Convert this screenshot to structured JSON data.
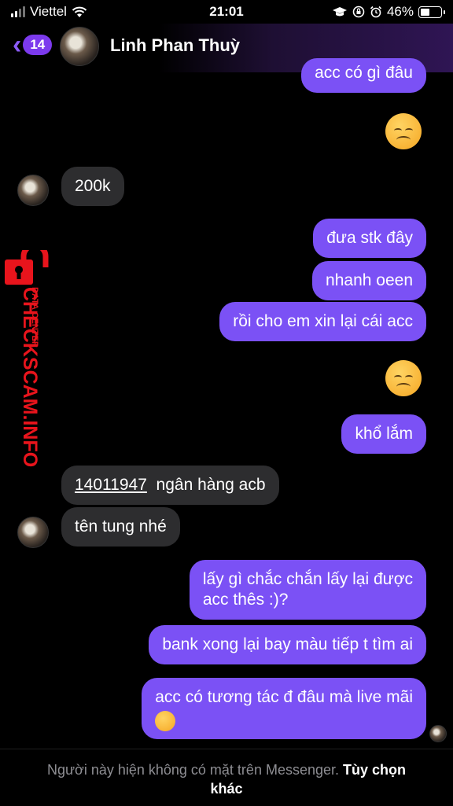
{
  "status_bar": {
    "carrier": "Viettel",
    "time": "21:01",
    "battery": "46%"
  },
  "header": {
    "back_count": "14",
    "contact_name": "Linh Phan Thuỳ"
  },
  "messages": [
    {
      "from": "me",
      "text": "acc có gì đâu"
    },
    {
      "from": "me",
      "type": "emoji",
      "icon": "disappointed-face-emoji"
    },
    {
      "from": "them",
      "text": "200k"
    },
    {
      "from": "me",
      "text": "đưa stk đây"
    },
    {
      "from": "me",
      "text": "nhanh oeen"
    },
    {
      "from": "me",
      "text": "rồi cho em xin lại cái acc"
    },
    {
      "from": "me",
      "type": "emoji",
      "icon": "disappointed-face-emoji"
    },
    {
      "from": "me",
      "text": "khổ lắm"
    },
    {
      "from": "them",
      "link": "14011947",
      "text": "ngân hàng acb"
    },
    {
      "from": "them",
      "text": "tên tung nhé"
    },
    {
      "from": "me",
      "lines": [
        "lấy gì chắc chắn lấy lại được",
        "acc thês :)?"
      ]
    },
    {
      "from": "me",
      "text": "bank xong lại bay màu tiếp t tìm ai"
    },
    {
      "from": "me",
      "lines": [
        "acc có tương tác đ đâu mà live mãi"
      ],
      "trailing_emoji": "disappointed-face-emoji"
    }
  ],
  "watermark": {
    "brand": "CHECKSCAM.INFO",
    "tag": "DATA CENTER"
  },
  "footer": {
    "notice": "Người này hiện không có mặt trên Messenger.",
    "option": "Tùy chọn khác"
  },
  "colors": {
    "outgoing_bubble": "#7b51f5",
    "incoming_bubble": "#2d2d2f",
    "accent": "#7c3aed",
    "watermark_red": "#e8141c"
  }
}
